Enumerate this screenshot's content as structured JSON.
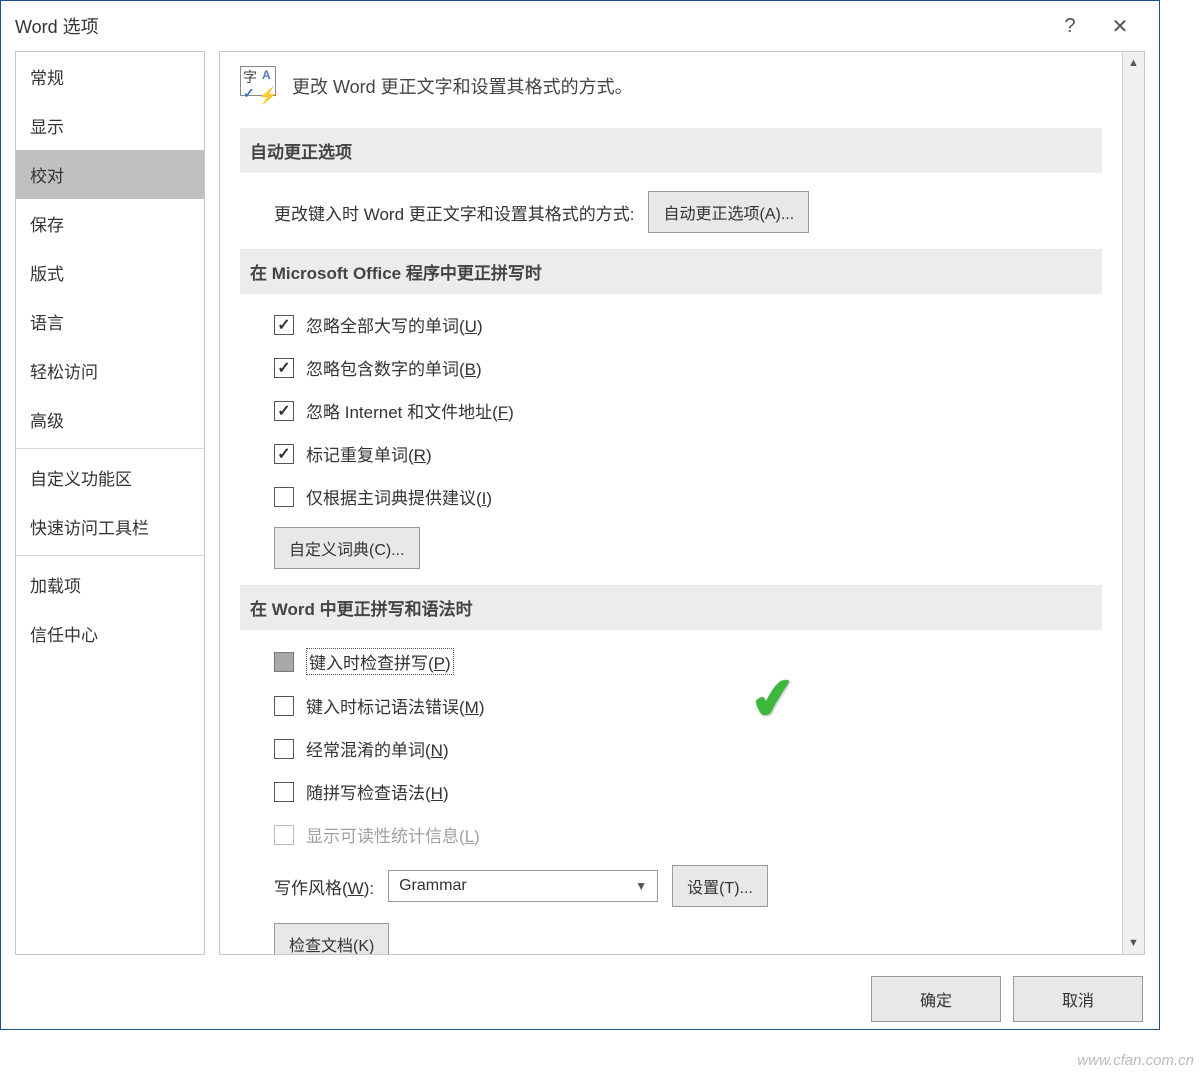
{
  "window": {
    "title": "Word 选项"
  },
  "titlebar": {
    "help": "?",
    "close": "✕"
  },
  "sidebar": {
    "items": [
      {
        "label": "常规"
      },
      {
        "label": "显示"
      },
      {
        "label": "校对",
        "selected": true
      },
      {
        "label": "保存"
      },
      {
        "label": "版式"
      },
      {
        "label": "语言"
      },
      {
        "label": "轻松访问"
      },
      {
        "label": "高级"
      }
    ],
    "items2": [
      {
        "label": "自定义功能区"
      },
      {
        "label": "快速访问工具栏"
      }
    ],
    "items3": [
      {
        "label": "加载项"
      },
      {
        "label": "信任中心"
      }
    ]
  },
  "content": {
    "header_title": "更改 Word 更正文字和设置其格式的方式。",
    "section1": {
      "title": "自动更正选项",
      "desc": "更改键入时 Word 更正文字和设置其格式的方式:",
      "button": "自动更正选项(A)..."
    },
    "section2": {
      "title": "在 Microsoft Office 程序中更正拼写时",
      "cb1": {
        "label_pre": "忽略全部大写的单词(",
        "key": "U",
        "label_post": ")",
        "checked": true
      },
      "cb2": {
        "label_pre": "忽略包含数字的单词(",
        "key": "B",
        "label_post": ")",
        "checked": true
      },
      "cb3": {
        "label_pre": "忽略 Internet 和文件地址(",
        "key": "F",
        "label_post": ")",
        "checked": true
      },
      "cb4": {
        "label_pre": "标记重复单词(",
        "key": "R",
        "label_post": ")",
        "checked": true
      },
      "cb5": {
        "label_pre": "仅根据主词典提供建议(",
        "key": "I",
        "label_post": ")",
        "checked": false
      },
      "button": "自定义词典(C)..."
    },
    "section3": {
      "title": "在 Word 中更正拼写和语法时",
      "cb1": {
        "label_pre": "键入时检查拼写(",
        "key": "P",
        "label_post": ")",
        "checked": false,
        "gray": true,
        "focus": true
      },
      "cb2": {
        "label_pre": "键入时标记语法错误(",
        "key": "M",
        "label_post": ")",
        "checked": false
      },
      "cb3": {
        "label_pre": "经常混淆的单词(",
        "key": "N",
        "label_post": ")",
        "checked": false
      },
      "cb4": {
        "label_pre": "随拼写检查语法(",
        "key": "H",
        "label_post": ")",
        "checked": false
      },
      "cb5": {
        "label_pre": "显示可读性统计信息(",
        "key": "L",
        "label_post": ")",
        "checked": false,
        "disabled": true
      },
      "style_label_pre": "写作风格(",
      "style_key": "W",
      "style_label_post": "):",
      "style_value": "Grammar",
      "settings_button": "设置(T)...",
      "check_doc_button": "检查文档(K)"
    }
  },
  "footer": {
    "ok": "确定",
    "cancel": "取消"
  },
  "watermark": "www.cfan.com.cn"
}
